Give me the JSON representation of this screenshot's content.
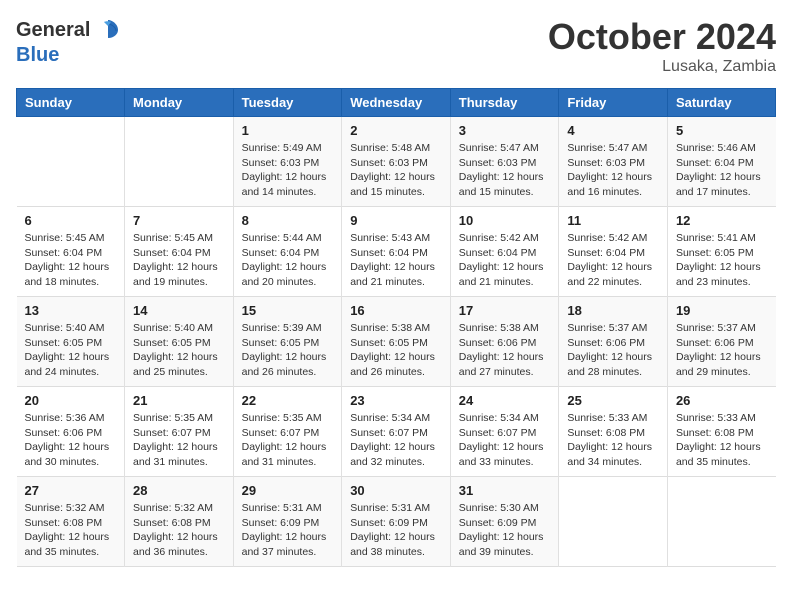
{
  "logo": {
    "general": "General",
    "blue": "Blue"
  },
  "title": "October 2024",
  "location": "Lusaka, Zambia",
  "days_header": [
    "Sunday",
    "Monday",
    "Tuesday",
    "Wednesday",
    "Thursday",
    "Friday",
    "Saturday"
  ],
  "weeks": [
    [
      {
        "day": "",
        "content": ""
      },
      {
        "day": "",
        "content": ""
      },
      {
        "day": "1",
        "content": "Sunrise: 5:49 AM\nSunset: 6:03 PM\nDaylight: 12 hours\nand 14 minutes."
      },
      {
        "day": "2",
        "content": "Sunrise: 5:48 AM\nSunset: 6:03 PM\nDaylight: 12 hours\nand 15 minutes."
      },
      {
        "day": "3",
        "content": "Sunrise: 5:47 AM\nSunset: 6:03 PM\nDaylight: 12 hours\nand 15 minutes."
      },
      {
        "day": "4",
        "content": "Sunrise: 5:47 AM\nSunset: 6:03 PM\nDaylight: 12 hours\nand 16 minutes."
      },
      {
        "day": "5",
        "content": "Sunrise: 5:46 AM\nSunset: 6:04 PM\nDaylight: 12 hours\nand 17 minutes."
      }
    ],
    [
      {
        "day": "6",
        "content": "Sunrise: 5:45 AM\nSunset: 6:04 PM\nDaylight: 12 hours\nand 18 minutes."
      },
      {
        "day": "7",
        "content": "Sunrise: 5:45 AM\nSunset: 6:04 PM\nDaylight: 12 hours\nand 19 minutes."
      },
      {
        "day": "8",
        "content": "Sunrise: 5:44 AM\nSunset: 6:04 PM\nDaylight: 12 hours\nand 20 minutes."
      },
      {
        "day": "9",
        "content": "Sunrise: 5:43 AM\nSunset: 6:04 PM\nDaylight: 12 hours\nand 21 minutes."
      },
      {
        "day": "10",
        "content": "Sunrise: 5:42 AM\nSunset: 6:04 PM\nDaylight: 12 hours\nand 21 minutes."
      },
      {
        "day": "11",
        "content": "Sunrise: 5:42 AM\nSunset: 6:04 PM\nDaylight: 12 hours\nand 22 minutes."
      },
      {
        "day": "12",
        "content": "Sunrise: 5:41 AM\nSunset: 6:05 PM\nDaylight: 12 hours\nand 23 minutes."
      }
    ],
    [
      {
        "day": "13",
        "content": "Sunrise: 5:40 AM\nSunset: 6:05 PM\nDaylight: 12 hours\nand 24 minutes."
      },
      {
        "day": "14",
        "content": "Sunrise: 5:40 AM\nSunset: 6:05 PM\nDaylight: 12 hours\nand 25 minutes."
      },
      {
        "day": "15",
        "content": "Sunrise: 5:39 AM\nSunset: 6:05 PM\nDaylight: 12 hours\nand 26 minutes."
      },
      {
        "day": "16",
        "content": "Sunrise: 5:38 AM\nSunset: 6:05 PM\nDaylight: 12 hours\nand 26 minutes."
      },
      {
        "day": "17",
        "content": "Sunrise: 5:38 AM\nSunset: 6:06 PM\nDaylight: 12 hours\nand 27 minutes."
      },
      {
        "day": "18",
        "content": "Sunrise: 5:37 AM\nSunset: 6:06 PM\nDaylight: 12 hours\nand 28 minutes."
      },
      {
        "day": "19",
        "content": "Sunrise: 5:37 AM\nSunset: 6:06 PM\nDaylight: 12 hours\nand 29 minutes."
      }
    ],
    [
      {
        "day": "20",
        "content": "Sunrise: 5:36 AM\nSunset: 6:06 PM\nDaylight: 12 hours\nand 30 minutes."
      },
      {
        "day": "21",
        "content": "Sunrise: 5:35 AM\nSunset: 6:07 PM\nDaylight: 12 hours\nand 31 minutes."
      },
      {
        "day": "22",
        "content": "Sunrise: 5:35 AM\nSunset: 6:07 PM\nDaylight: 12 hours\nand 31 minutes."
      },
      {
        "day": "23",
        "content": "Sunrise: 5:34 AM\nSunset: 6:07 PM\nDaylight: 12 hours\nand 32 minutes."
      },
      {
        "day": "24",
        "content": "Sunrise: 5:34 AM\nSunset: 6:07 PM\nDaylight: 12 hours\nand 33 minutes."
      },
      {
        "day": "25",
        "content": "Sunrise: 5:33 AM\nSunset: 6:08 PM\nDaylight: 12 hours\nand 34 minutes."
      },
      {
        "day": "26",
        "content": "Sunrise: 5:33 AM\nSunset: 6:08 PM\nDaylight: 12 hours\nand 35 minutes."
      }
    ],
    [
      {
        "day": "27",
        "content": "Sunrise: 5:32 AM\nSunset: 6:08 PM\nDaylight: 12 hours\nand 35 minutes."
      },
      {
        "day": "28",
        "content": "Sunrise: 5:32 AM\nSunset: 6:08 PM\nDaylight: 12 hours\nand 36 minutes."
      },
      {
        "day": "29",
        "content": "Sunrise: 5:31 AM\nSunset: 6:09 PM\nDaylight: 12 hours\nand 37 minutes."
      },
      {
        "day": "30",
        "content": "Sunrise: 5:31 AM\nSunset: 6:09 PM\nDaylight: 12 hours\nand 38 minutes."
      },
      {
        "day": "31",
        "content": "Sunrise: 5:30 AM\nSunset: 6:09 PM\nDaylight: 12 hours\nand 39 minutes."
      },
      {
        "day": "",
        "content": ""
      },
      {
        "day": "",
        "content": ""
      }
    ]
  ]
}
